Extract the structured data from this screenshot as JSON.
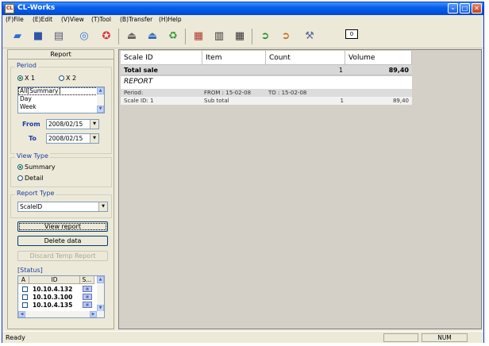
{
  "window": {
    "title": "CL-Works",
    "app_icon_text": "CL"
  },
  "menu": [
    "(F)File",
    "(E)Edit",
    "(V)View",
    "(T)Tool",
    "(B)Transfer",
    "(H)Help"
  ],
  "toolbar": {
    "tools": [
      "open-icon",
      "save-icon",
      "print-icon",
      "settings-icon",
      "star-icon",
      "send-icon",
      "receive-icon",
      "recycle-icon",
      "report-list-icon",
      "report-card-icon",
      "keyboard-icon",
      "forward-icon",
      "back-icon",
      "tools-icon"
    ],
    "counter": "0"
  },
  "left_panel": {
    "title": "Report",
    "period": {
      "label": "Period",
      "x1": "X 1",
      "x2": "X 2",
      "options": [
        "All[Summary]",
        "Day",
        "Week"
      ],
      "from_label": "From",
      "from_value": "2008/02/15",
      "to_label": "To",
      "to_value": "2008/02/15"
    },
    "view_type": {
      "label": "View Type",
      "summary": "Summary",
      "detail": "Detail"
    },
    "report_type": {
      "label": "Report Type",
      "value": "ScaleID"
    },
    "buttons": {
      "view_report": "View report",
      "delete_data": "Delete data",
      "discard_temp": "Discard Temp Report"
    },
    "status": {
      "label": "[Status]",
      "headers": [
        "A",
        "ID",
        "S..."
      ],
      "rows": [
        {
          "id": "10.10.4.132"
        },
        {
          "id": "10.10.3.100"
        },
        {
          "id": "10.10.4.135"
        }
      ]
    }
  },
  "report": {
    "headers": [
      "Scale ID",
      "Item",
      "Count",
      "Volume"
    ],
    "total_row": {
      "label": "Total sale",
      "count": "1",
      "volume": "89,40"
    },
    "title": "REPORT",
    "period_row": {
      "label": "Period:",
      "from": "FROM : 15-02-08",
      "to": "TO : 15-02-08"
    },
    "detail_row": {
      "scale": "Scale ID: 1",
      "item": "Sub total",
      "count": "1",
      "volume": "89,40"
    }
  },
  "statusbar": {
    "text": "Ready",
    "num": "NUM"
  }
}
